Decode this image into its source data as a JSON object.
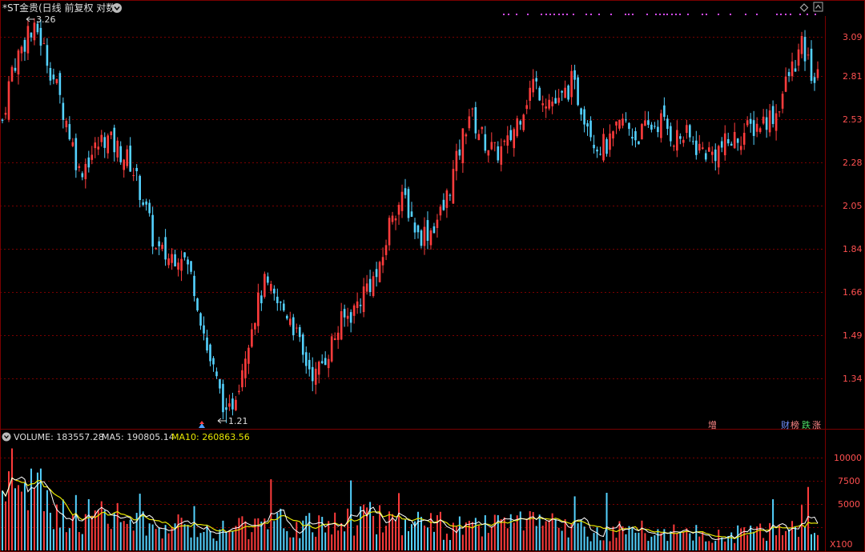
{
  "title": "*ST金贵(日线 前复权 对数)",
  "markers": {
    "high_label": "3.26",
    "low_label": "1.21"
  },
  "price_axis": {
    "ticks": [
      "3.09",
      "2.81",
      "2.53",
      "2.28",
      "2.05",
      "1.84",
      "1.66",
      "1.49",
      "1.34"
    ]
  },
  "volume_header": {
    "volume_label": "VOLUME: 183557.28",
    "ma5_label": "MA5: 190805.14",
    "ma10_label": "MA10: 260863.56"
  },
  "volume_axis": {
    "ticks": [
      "10000",
      "7500",
      "5000"
    ],
    "unit": "X100"
  },
  "tags": {
    "zeng": "增",
    "cai": "财",
    "bang": "榜",
    "die": "跌",
    "zhang": "涨"
  },
  "colors": {
    "up": "#ff3c3c",
    "down": "#54d2ff",
    "grid": "#7a0000",
    "ma5": "#ffffff",
    "ma10": "#e6e600",
    "dots": "#d54bff"
  },
  "chart_data": {
    "type": "candlestick",
    "scale": "log",
    "y_range": [
      1.2,
      3.3
    ],
    "high_value": 3.26,
    "low_value": 1.21,
    "close_path": [
      [
        0,
        2.55
      ],
      [
        3,
        2.9
      ],
      [
        7,
        3.1
      ],
      [
        11,
        3.18
      ],
      [
        15,
        2.9
      ],
      [
        20,
        2.55
      ],
      [
        24,
        2.25
      ],
      [
        28,
        2.35
      ],
      [
        32,
        2.45
      ],
      [
        36,
        2.38
      ],
      [
        40,
        2.3
      ],
      [
        44,
        2.1
      ],
      [
        48,
        1.85
      ],
      [
        52,
        1.82
      ],
      [
        56,
        1.85
      ],
      [
        60,
        1.7
      ],
      [
        64,
        1.45
      ],
      [
        68,
        1.3
      ],
      [
        71,
        1.24
      ],
      [
        74,
        1.35
      ],
      [
        78,
        1.55
      ],
      [
        82,
        1.7
      ],
      [
        86,
        1.62
      ],
      [
        90,
        1.58
      ],
      [
        94,
        1.42
      ],
      [
        98,
        1.36
      ],
      [
        102,
        1.45
      ],
      [
        106,
        1.55
      ],
      [
        110,
        1.6
      ],
      [
        114,
        1.7
      ],
      [
        118,
        1.75
      ],
      [
        122,
        2.05
      ],
      [
        126,
        2.1
      ],
      [
        130,
        1.92
      ],
      [
        134,
        1.95
      ],
      [
        138,
        2.05
      ],
      [
        142,
        2.3
      ],
      [
        146,
        2.6
      ],
      [
        150,
        2.45
      ],
      [
        154,
        2.35
      ],
      [
        158,
        2.4
      ],
      [
        162,
        2.6
      ],
      [
        166,
        2.8
      ],
      [
        170,
        2.7
      ],
      [
        174,
        2.65
      ],
      [
        178,
        2.8
      ],
      [
        182,
        2.6
      ],
      [
        186,
        2.4
      ],
      [
        190,
        2.4
      ],
      [
        194,
        2.55
      ],
      [
        198,
        2.45
      ],
      [
        202,
        2.5
      ],
      [
        206,
        2.55
      ],
      [
        210,
        2.45
      ],
      [
        214,
        2.45
      ],
      [
        218,
        2.38
      ],
      [
        222,
        2.35
      ],
      [
        226,
        2.4
      ],
      [
        230,
        2.45
      ],
      [
        234,
        2.5
      ],
      [
        238,
        2.55
      ],
      [
        242,
        2.6
      ],
      [
        246,
        2.85
      ],
      [
        250,
        3.05
      ],
      [
        254,
        2.82
      ]
    ],
    "volume_ma10_path": [
      [
        0,
        6500
      ],
      [
        6,
        7200
      ],
      [
        10,
        6800
      ],
      [
        15,
        3800
      ],
      [
        25,
        3600
      ],
      [
        35,
        3400
      ],
      [
        45,
        2600
      ],
      [
        55,
        2400
      ],
      [
        65,
        2200
      ],
      [
        75,
        2500
      ],
      [
        85,
        2800
      ],
      [
        95,
        2400
      ],
      [
        105,
        3000
      ],
      [
        115,
        3600
      ],
      [
        125,
        3100
      ],
      [
        135,
        2600
      ],
      [
        145,
        2200
      ],
      [
        155,
        2500
      ],
      [
        165,
        2600
      ],
      [
        175,
        2400
      ],
      [
        185,
        2100
      ],
      [
        195,
        2000
      ],
      [
        205,
        1900
      ],
      [
        215,
        1700
      ],
      [
        225,
        1500
      ],
      [
        235,
        1800
      ],
      [
        245,
        2400
      ],
      [
        250,
        3200
      ],
      [
        254,
        2900
      ]
    ]
  }
}
